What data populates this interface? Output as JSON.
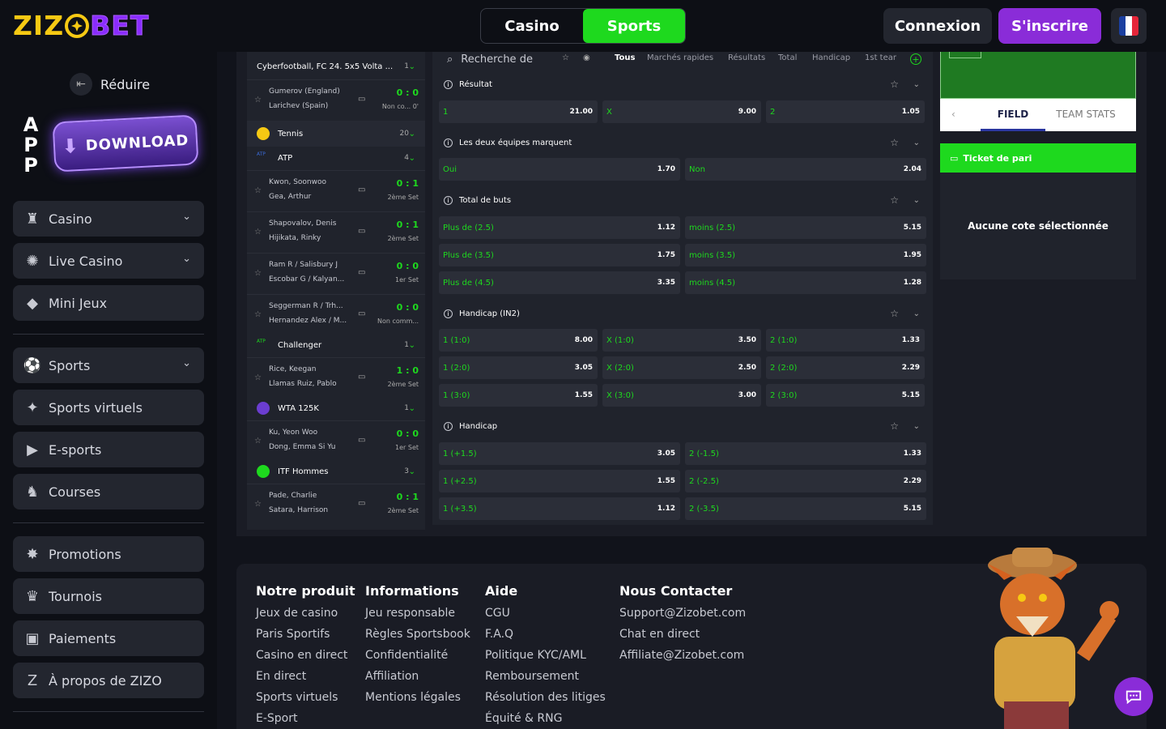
{
  "header": {
    "logo_left": "ZIZ",
    "logo_right": "BET",
    "tab_casino": "Casino",
    "tab_sports": "Sports",
    "login": "Connexion",
    "signup": "S'inscrire"
  },
  "sidebar": {
    "reduce": "Réduire",
    "app": "APP",
    "download": "DOWNLOAD",
    "items": [
      {
        "label": "Casino",
        "icon": "casino-icon"
      },
      {
        "label": "Live Casino",
        "icon": "live-casino-icon"
      },
      {
        "label": "Mini Jeux",
        "icon": "diamond-icon"
      },
      {
        "label": "Sports",
        "icon": "ball-icon"
      },
      {
        "label": "Sports virtuels",
        "icon": "virtual-sports-icon"
      },
      {
        "label": "E-sports",
        "icon": "play-icon"
      },
      {
        "label": "Courses",
        "icon": "horse-icon"
      },
      {
        "label": "Promotions",
        "icon": "promo-icon"
      },
      {
        "label": "Tournois",
        "icon": "trophy-icon"
      },
      {
        "label": "Paiements",
        "icon": "wallet-icon"
      },
      {
        "label": "À propos de ZIZO",
        "icon": "zizo-icon"
      }
    ]
  },
  "games": {
    "league0": {
      "label": "Cyberfootball, FC 24. 5x5 Volta ...",
      "count": "1"
    },
    "m0": {
      "t1": "Gumerov (England)",
      "t2": "Larichev (Spain)",
      "score": "0 : 0",
      "status": "Non co... 0'"
    },
    "tennis": {
      "label": "Tennis",
      "count": "20"
    },
    "atp": {
      "label": "ATP",
      "count": "4"
    },
    "m1": {
      "t1": "Kwon, Soonwoo",
      "t2": "Gea, Arthur",
      "score": "0 : 1",
      "status": "2ème Set"
    },
    "m2": {
      "t1": "Shapovalov, Denis",
      "t2": "Hijikata, Rinky",
      "score": "0 : 1",
      "status": "2ème Set"
    },
    "m3": {
      "t1": "Ram R / Salisbury J",
      "t2": "Escobar G / Kalyan...",
      "score": "0 : 0",
      "status": "1er Set"
    },
    "m4": {
      "t1": "Seggerman R / Trh...",
      "t2": "Hernandez Alex / M...",
      "score": "0 : 0",
      "status": "Non comm..."
    },
    "challenger": {
      "label": "Challenger",
      "count": "1"
    },
    "m5": {
      "t1": "Rice, Keegan",
      "t2": "Llamas Ruiz, Pablo",
      "score": "1 : 0",
      "status": "2ème Set"
    },
    "wta": {
      "label": "WTA 125K",
      "count": "1"
    },
    "m6": {
      "t1": "Ku, Yeon Woo",
      "t2": "Dong, Emma Si Yu",
      "score": "0 : 0",
      "status": "1er Set"
    },
    "itf": {
      "label": "ITF Hommes",
      "count": "3"
    },
    "m7": {
      "t1": "Pade, Charlie",
      "t2": "Satara, Harrison",
      "score": "0 : 1",
      "status": "2ème Set"
    }
  },
  "markets": {
    "search_placeholder": "Recherche de",
    "tabs": [
      "Tous",
      "Marchés rapides",
      "Résultats",
      "Total",
      "Handicap",
      "1st tear"
    ],
    "resultat": {
      "title": "Résultat",
      "odds": [
        [
          "1",
          "21.00"
        ],
        [
          "X",
          "9.00"
        ],
        [
          "2",
          "1.05"
        ]
      ]
    },
    "btts": {
      "title": "Les deux équipes marquent",
      "odds": [
        [
          "Oui",
          "1.70"
        ],
        [
          "Non",
          "2.04"
        ]
      ]
    },
    "total": {
      "title": "Total de buts",
      "odds": [
        [
          "Plus de (2.5)",
          "1.12"
        ],
        [
          "moins (2.5)",
          "5.15"
        ],
        [
          "Plus de (3.5)",
          "1.75"
        ],
        [
          "moins (3.5)",
          "1.95"
        ],
        [
          "Plus de (4.5)",
          "3.35"
        ],
        [
          "moins (4.5)",
          "1.28"
        ]
      ]
    },
    "hcp3": {
      "title": "Handicap (IN2)",
      "odds": [
        [
          "1 (1:0)",
          "8.00"
        ],
        [
          "X (1:0)",
          "3.50"
        ],
        [
          "2 (1:0)",
          "1.33"
        ],
        [
          "1 (2:0)",
          "3.05"
        ],
        [
          "X (2:0)",
          "2.50"
        ],
        [
          "2 (2:0)",
          "2.29"
        ],
        [
          "1 (3:0)",
          "1.55"
        ],
        [
          "X (3:0)",
          "3.00"
        ],
        [
          "2 (3:0)",
          "5.15"
        ]
      ]
    },
    "hcp2": {
      "title": "Handicap",
      "odds": [
        [
          "1 (+1.5)",
          "3.05"
        ],
        [
          "2 (-1.5)",
          "1.33"
        ],
        [
          "1 (+2.5)",
          "1.55"
        ],
        [
          "2 (-2.5)",
          "2.29"
        ],
        [
          "1 (+3.5)",
          "1.12"
        ],
        [
          "2 (-3.5)",
          "5.15"
        ]
      ]
    }
  },
  "right": {
    "field": "FIELD",
    "team_stats": "TEAM STATS",
    "ticket": "Ticket de pari",
    "empty": "Aucune cote sélectionnée"
  },
  "footer": {
    "col1": {
      "title": "Notre produit",
      "links": [
        "Jeux de casino",
        "Paris Sportifs",
        "Casino en direct",
        "En direct",
        "Sports virtuels",
        "E-Sport"
      ]
    },
    "col2": {
      "title": "Informations",
      "links": [
        "Jeu responsable",
        "Règles Sportsbook",
        "Confidentialité",
        "Affiliation",
        "Mentions légales"
      ]
    },
    "col3": {
      "title": "Aide",
      "links": [
        "CGU",
        "F.A.Q",
        "Politique KYC/AML",
        "Remboursement",
        "Résolution des litiges",
        "Équité & RNG"
      ]
    },
    "col4": {
      "title": "Nous Contacter",
      "links": [
        "Support@Zizobet.com",
        "Chat en direct",
        "Affiliate@Zizobet.com"
      ]
    }
  },
  "colors": {
    "green": "#1ed91e",
    "purple": "#8a2cd8",
    "bg": "#11131b",
    "panel": "#20232c"
  }
}
